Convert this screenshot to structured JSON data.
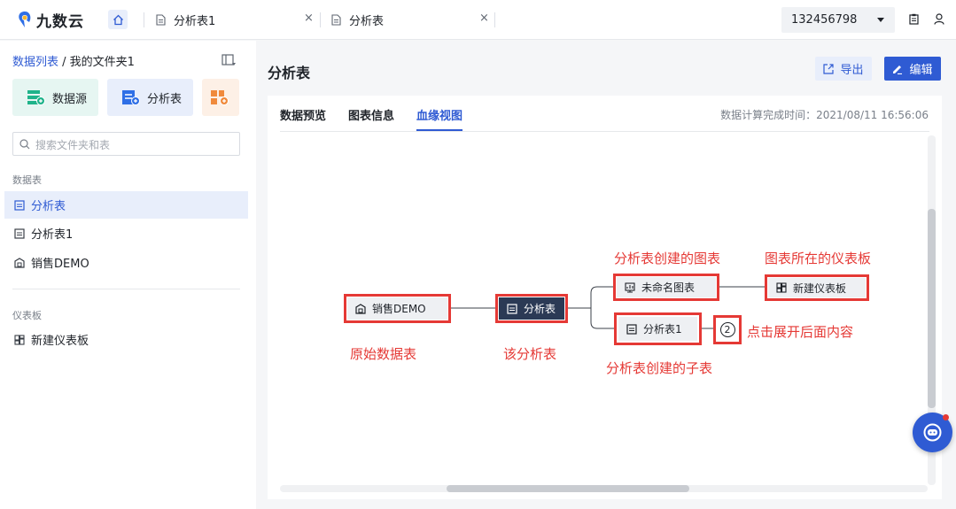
{
  "app": {
    "logo_text": "九数云"
  },
  "tabs": [
    {
      "label": "分析表1",
      "close": "×"
    },
    {
      "label": "分析表",
      "close": "×"
    }
  ],
  "account": {
    "selected": "132456798"
  },
  "sidebar": {
    "breadcrumb_root": "数据列表",
    "breadcrumb_sep": " / ",
    "breadcrumb_current": "我的文件夹1",
    "quick_actions": [
      {
        "label": "数据源"
      },
      {
        "label": "分析表"
      }
    ],
    "search_placeholder": "搜索文件夹和表",
    "section_tables": "数据表",
    "tables": [
      {
        "label": "分析表",
        "active": true
      },
      {
        "label": "分析表1"
      },
      {
        "label": "销售DEMO"
      }
    ],
    "section_dashboards": "仪表板",
    "dashboards": [
      {
        "label": "新建仪表板"
      }
    ]
  },
  "main": {
    "title": "分析表",
    "export_label": "导出",
    "edit_label": "编辑",
    "panel_tabs": [
      {
        "label": "数据预览"
      },
      {
        "label": "图表信息"
      },
      {
        "label": "血缘视图",
        "active": true
      }
    ],
    "calc_time": "数据计算完成时间：2021/08/11 16:56:06"
  },
  "lineage": {
    "nodes": {
      "source": "销售DEMO",
      "current": "分析表",
      "chart": "未命名图表",
      "dashboard": "新建仪表板",
      "child": "分析表1",
      "expand_count": "2"
    },
    "annotations": {
      "source": "原始数据表",
      "current": "该分析表",
      "chart": "分析表创建的图表",
      "dashboard": "图表所在的仪表板",
      "child": "分析表创建的子表",
      "expand": "点击展开后面内容"
    }
  },
  "colors": {
    "accent": "#2f5bd3",
    "annotation": "#e53935",
    "dark_node": "#2b3a55"
  }
}
